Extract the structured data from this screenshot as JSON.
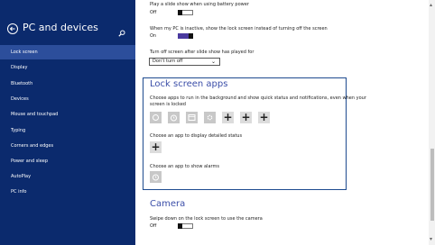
{
  "sidebar": {
    "title": "PC and devices",
    "items": [
      {
        "label": "Lock screen",
        "selected": true
      },
      {
        "label": "Display"
      },
      {
        "label": "Bluetooth"
      },
      {
        "label": "Devices"
      },
      {
        "label": "Mouse and touchpad"
      },
      {
        "label": "Typing"
      },
      {
        "label": "Corners and edges"
      },
      {
        "label": "Power and sleep"
      },
      {
        "label": "AutoPlay"
      },
      {
        "label": "PC info"
      }
    ]
  },
  "settings": {
    "battery_desc": "Play a slide show when using battery power",
    "battery_state": "Off",
    "inactive_desc": "When my PC is inactive, show the lock screen instead of turning off the screen",
    "inactive_state": "On",
    "turnoff_desc": "Turn off screen after slide show has played for",
    "turnoff_value": "Don't turn off"
  },
  "lock_apps": {
    "title": "Lock screen apps",
    "desc_line1": "Choose apps to run in the background and show quick status and notifications, even when your",
    "desc_line2": "screen is locked",
    "detailed_desc": "Choose an app to display detailed status",
    "alarms_desc": "Choose an app to show alarms",
    "plus": "+"
  },
  "camera": {
    "title": "Camera",
    "desc": "Swipe down on the lock screen to use the camera",
    "state": "Off"
  },
  "colors": {
    "sidebar_bg": "#0b2a6d",
    "sidebar_selected": "#2c4e9b",
    "accent": "#3b4ea8",
    "box_border": "#1e4b8f"
  },
  "icons": [
    "back-arrow-icon",
    "search-icon",
    "camera-app-icon",
    "alarm-app-icon",
    "calendar-app-icon",
    "settings-app-icon",
    "plus-icon",
    "alarm-clock-icon"
  ]
}
